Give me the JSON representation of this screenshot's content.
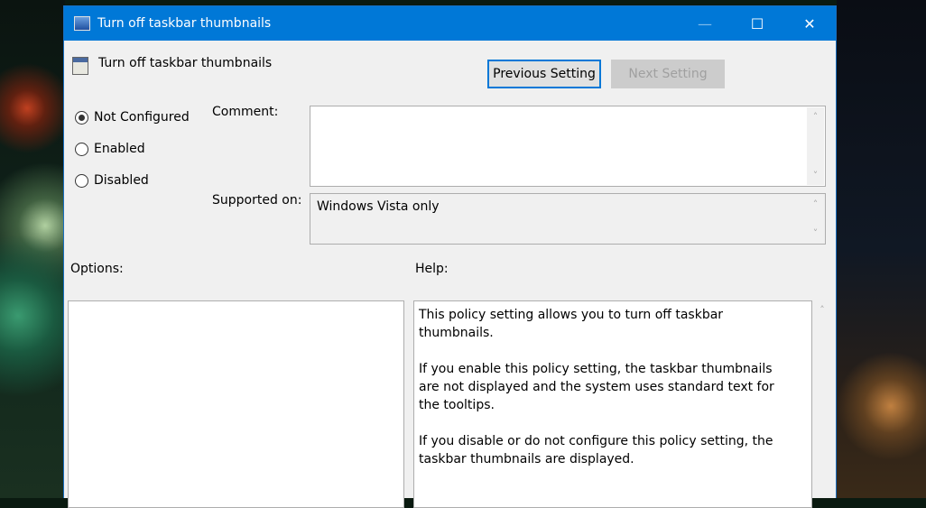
{
  "window": {
    "title": "Turn off taskbar thumbnails",
    "minimize": "—",
    "maximize": "☐",
    "close": "✕"
  },
  "header": {
    "title": "Turn off taskbar thumbnails",
    "previous_label": "Previous Setting",
    "next_label": "Next Setting"
  },
  "state": {
    "options": [
      {
        "label": "Not Configured",
        "selected": true
      },
      {
        "label": "Enabled",
        "selected": false
      },
      {
        "label": "Disabled",
        "selected": false
      }
    ]
  },
  "comment": {
    "label": "Comment:",
    "value": ""
  },
  "supported": {
    "label": "Supported on:",
    "value": "Windows Vista only"
  },
  "options_label": "Options:",
  "help": {
    "label": "Help:",
    "paragraphs": [
      "This policy setting allows you to turn off taskbar thumbnails.",
      "If you enable this policy setting, the taskbar thumbnails are not displayed and the system uses standard text for the tooltips.",
      "If you disable or do not configure this policy setting, the taskbar thumbnails are displayed."
    ]
  },
  "scroll": {
    "up": "˄",
    "down": "˅"
  }
}
